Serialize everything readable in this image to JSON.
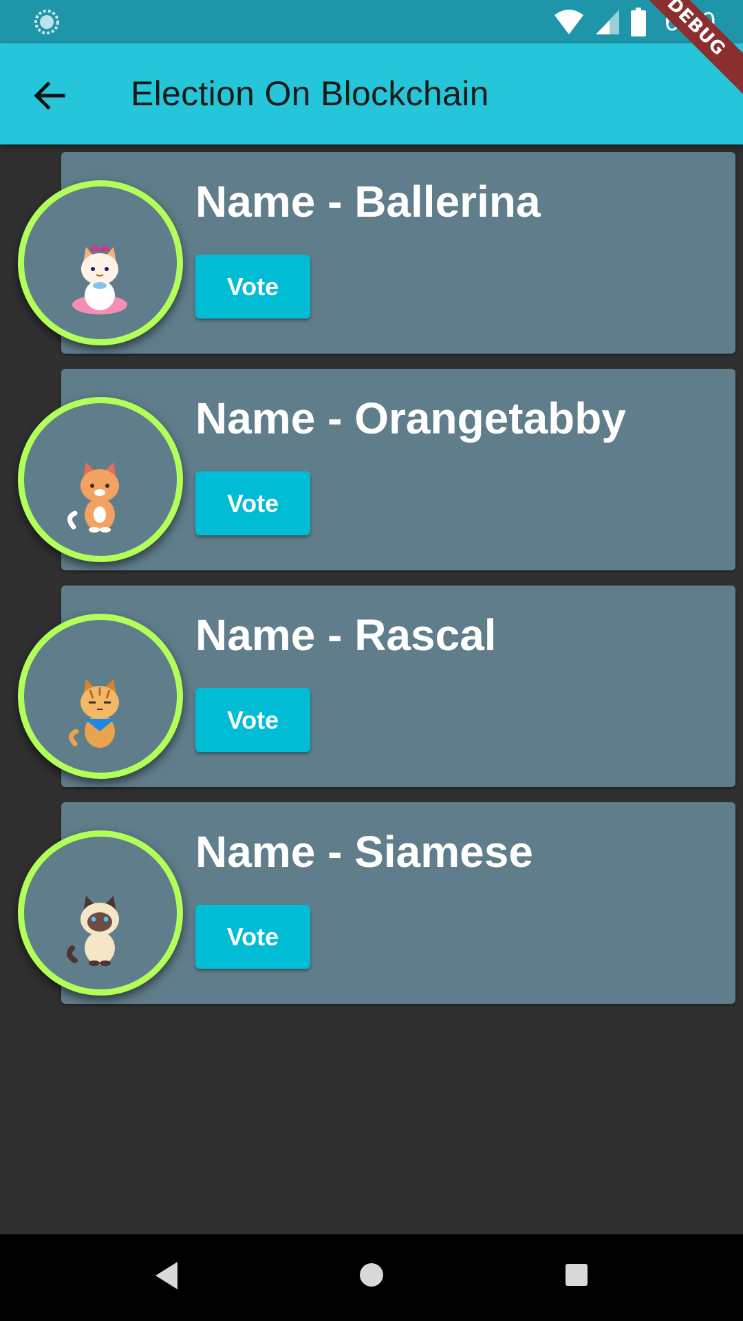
{
  "status_bar": {
    "time": "6:30",
    "icons": [
      "sync-icon",
      "wifi-icon",
      "signal-icon",
      "battery-icon"
    ]
  },
  "app_bar": {
    "title": "Election On Blockchain",
    "back_icon": "arrow-back-icon"
  },
  "debug_banner": "DEBUG",
  "candidates": [
    {
      "name": "Name - Ballerina",
      "vote_label": "Vote",
      "avatar": "ballerina-cat",
      "accent": "#f48fb1"
    },
    {
      "name": "Name - Orangetabby",
      "vote_label": "Vote",
      "avatar": "orange-tabby-cat",
      "accent": "#f4a261"
    },
    {
      "name": "Name - Rascal",
      "vote_label": "Vote",
      "avatar": "rascal-cat",
      "accent": "#e9a34f"
    },
    {
      "name": "Name - Siamese",
      "vote_label": "Vote",
      "avatar": "siamese-cat",
      "accent": "#5d4037"
    }
  ],
  "colors": {
    "app_bar": "#26c6da",
    "status_bar": "#1e95a9",
    "card": "#607d8b",
    "avatar_ring": "#b2ff59",
    "vote_button": "#00bcd4",
    "background": "#303030"
  },
  "nav_bar": {
    "icons": [
      "nav-back-icon",
      "nav-home-icon",
      "nav-recents-icon"
    ]
  }
}
